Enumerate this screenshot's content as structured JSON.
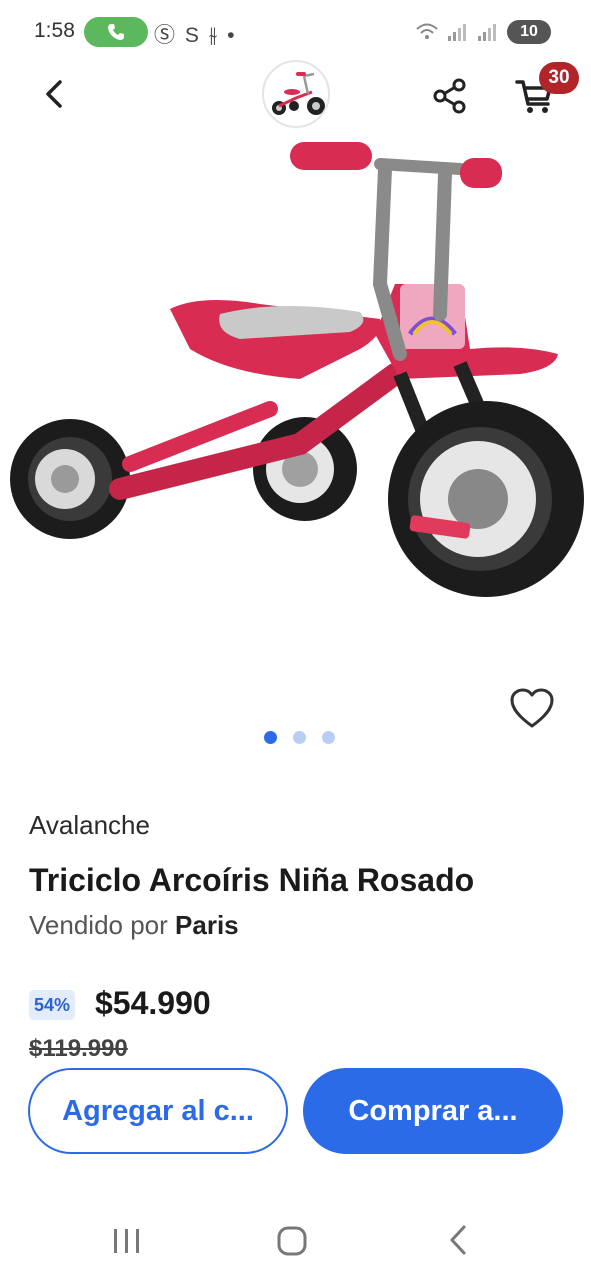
{
  "status_bar": {
    "time": "1:58",
    "left_icons": "Ⓢ S ⫳ •",
    "battery": "10"
  },
  "header": {
    "cart_count": "30"
  },
  "product": {
    "brand": "Avalanche",
    "title": "Triciclo Arcoíris Niña Rosado",
    "sold_by_label": "Vendido por",
    "seller": "Paris",
    "discount": "54%",
    "price": "$54.990",
    "old_price": "$119.990",
    "image_count": 3,
    "active_image": 1
  },
  "actions": {
    "add_to_cart": "Agregar al c...",
    "buy_now": "Comprar a..."
  },
  "colors": {
    "accent": "#2c6be8",
    "badge": "#b0242a",
    "product_pink": "#d92c52"
  },
  "icons": [
    "back-arrow-icon",
    "share-icon",
    "cart-icon",
    "heart-icon",
    "phone-icon",
    "recents-icon",
    "home-icon",
    "nav-back-icon"
  ]
}
